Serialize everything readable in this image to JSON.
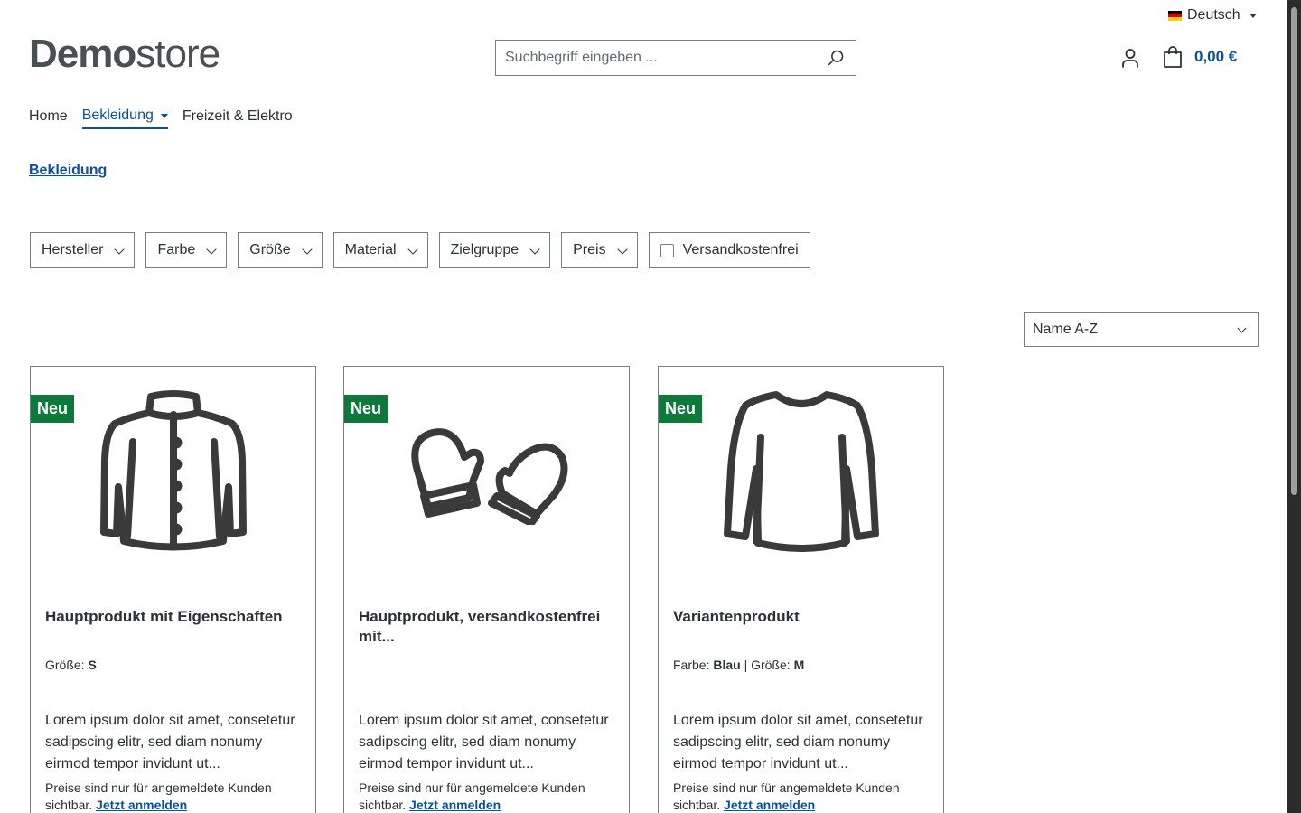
{
  "language": {
    "label": "Deutsch",
    "flag_colors": [
      "#000000",
      "#dd0000",
      "#ffce00"
    ]
  },
  "logo": {
    "bold": "Demo",
    "light": "store"
  },
  "search": {
    "placeholder": "Suchbegriff eingeben ..."
  },
  "cart": {
    "total": "0,00 €"
  },
  "nav": {
    "items": [
      "Home",
      "Bekleidung",
      "Freizeit & Elektro"
    ],
    "active": "Bekleidung"
  },
  "breadcrumb": "Bekleidung",
  "filters": [
    "Hersteller",
    "Farbe",
    "Größe",
    "Material",
    "Zielgruppe",
    "Preis"
  ],
  "shipping_filter": "Versandkostenfrei",
  "sort": {
    "value": "Name A-Z"
  },
  "products": [
    {
      "badge": "Neu",
      "title": "Hauptprodukt mit Eigenschaften",
      "prop1_label": "Größe: ",
      "prop1_value": "S",
      "description": "Lorem ipsum dolor sit amet, consetetur sadipscing elitr, sed diam nonumy eirmod tempor invidunt ut...",
      "note": "Preise sind nur für angemeldete Kunden sichtbar. ",
      "login": "Jetzt anmelden",
      "icon": "jacket-icon"
    },
    {
      "badge": "Neu",
      "title": "Hauptprodukt, versandkostenfrei mit...",
      "description": "Lorem ipsum dolor sit amet, consetetur sadipscing elitr, sed diam nonumy eirmod tempor invidunt ut...",
      "note": "Preise sind nur für angemeldete Kunden sichtbar. ",
      "login": "Jetzt anmelden",
      "icon": "mittens-icon"
    },
    {
      "badge": "Neu",
      "title": "Variantenprodukt",
      "prop1_label": "Farbe: ",
      "prop1_value": "Blau",
      "prop_sep": " | ",
      "prop2_label": "Größe: ",
      "prop2_value": "M",
      "description": "Lorem ipsum dolor sit amet, consetetur sadipscing elitr, sed diam nonumy eirmod tempor invidunt ut...",
      "note": "Preise sind nur für angemeldete Kunden sichtbar. ",
      "login": "Jetzt anmelden",
      "icon": "sweater-icon"
    }
  ],
  "colors": {
    "accent": "#0b4fa2",
    "badge": "#0d7a3c",
    "text": "#2b3136",
    "border": "#7a7e82"
  }
}
